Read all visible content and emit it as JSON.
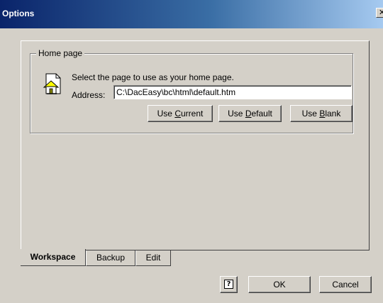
{
  "window": {
    "title": "Options",
    "close_glyph": "✕"
  },
  "home_page": {
    "group_label": "Home page",
    "icon": "home-page-icon",
    "prompt": "Select the page to use as your home page.",
    "address_label": "Address:",
    "address_value": "C:\\DacEasy\\bc\\html\\default.htm",
    "use_current": {
      "pre": "Use ",
      "key": "C",
      "post": "urrent"
    },
    "use_default": {
      "pre": "Use ",
      "key": "D",
      "post": "efault"
    },
    "use_blank": {
      "pre": "Use ",
      "key": "B",
      "post": "lank"
    }
  },
  "tabs": [
    {
      "label": "Workspace",
      "active": true
    },
    {
      "label": "Backup",
      "active": false
    },
    {
      "label": "Edit",
      "active": false
    }
  ],
  "footer": {
    "help_glyph": "?",
    "ok_label": "OK",
    "cancel_label": "Cancel"
  },
  "colors": {
    "title_start": "#0a246a",
    "title_end": "#a6caf0",
    "face": "#d4d0c8"
  }
}
